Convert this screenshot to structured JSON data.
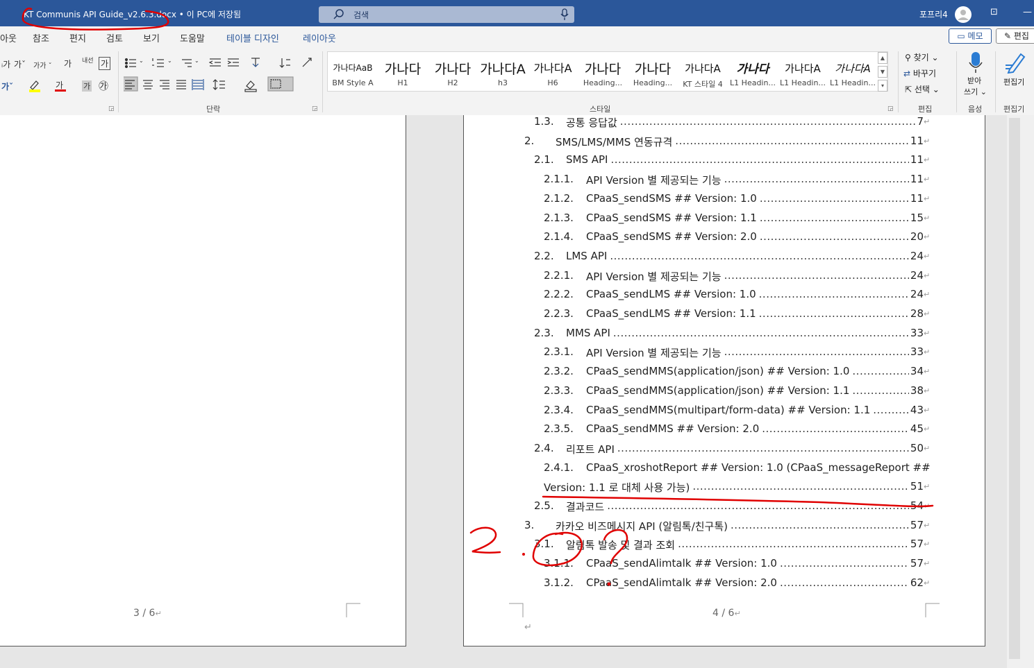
{
  "titlebar": {
    "doc_title": "KT Communis API Guide_v2.6.3.docx  •  이 PC에 저장됨",
    "search_placeholder": "검색",
    "user_name": "포프리4",
    "restore_glyph": "⊡",
    "minimize_glyph": "—"
  },
  "tabs": [
    {
      "label": "아웃"
    },
    {
      "label": "참조"
    },
    {
      "label": "편지"
    },
    {
      "label": "검토"
    },
    {
      "label": "보기"
    },
    {
      "label": "도움말"
    },
    {
      "label": "테이블 디자인"
    },
    {
      "label": "레이아웃"
    }
  ],
  "buttons": {
    "memo": "메모",
    "edit": "편집"
  },
  "ribbon": {
    "paragraph_label": "단락",
    "styles_label": "스타일",
    "editing_label": "편집",
    "voice_label": "음성",
    "editor_label": "편집기",
    "find": "찾기",
    "replace": "바꾸기",
    "select": "선택",
    "dictate_1": "받아",
    "dictate_2": "쓰기",
    "editor_btn": "편집기",
    "font_glyphs": {
      "small_ga": "가",
      "ga": "가",
      "gaga": "가가",
      "ga2": "가",
      "naesem": "내선",
      "box_ga": "가",
      "chars": "가",
      "red_ga": "가",
      "gray_ga": "가",
      "circle_ga": "㉮"
    }
  },
  "styles": [
    {
      "sample": "가나다AaB",
      "name": "BM Style A",
      "small": true
    },
    {
      "sample": "가나다",
      "name": "H1"
    },
    {
      "sample": "가나다",
      "name": "H2"
    },
    {
      "sample": "가나다A",
      "name": "h3"
    },
    {
      "sample": "가나다A",
      "name": "H6"
    },
    {
      "sample": "가나다",
      "name": "Heading..."
    },
    {
      "sample": "가나다",
      "name": "Heading..."
    },
    {
      "sample": "가나다A",
      "name": "KT 스타일 4"
    },
    {
      "sample": "가나다",
      "name": "L1 Headin..."
    },
    {
      "sample": "가나다A",
      "name": "L1 Headin..."
    },
    {
      "sample": "가나다A",
      "name": "L1 Headin..."
    }
  ],
  "toc": [
    {
      "num": "1.3.",
      "text": "공통 응답값",
      "page": "7"
    },
    {
      "num": "2.",
      "text": "SMS/LMS/MMS 연동규격",
      "page": "11"
    },
    {
      "num": "2.1.",
      "text": "SMS API",
      "page": "11"
    },
    {
      "num": "2.1.1.",
      "text": "API Version 별 제공되는 기능",
      "page": "11"
    },
    {
      "num": "2.1.2.",
      "text": "CPaaS_sendSMS ## Version: 1.0",
      "page": "11"
    },
    {
      "num": "2.1.3.",
      "text": "CPaaS_sendSMS ## Version: 1.1",
      "page": "15"
    },
    {
      "num": "2.1.4.",
      "text": "CPaaS_sendSMS ## Version: 2.0",
      "page": "20"
    },
    {
      "num": "2.2.",
      "text": "LMS API",
      "page": "24"
    },
    {
      "num": "2.2.1.",
      "text": "API Version 별 제공되는 기능",
      "page": "24"
    },
    {
      "num": "2.2.2.",
      "text": "CPaaS_sendLMS ## Version: 1.0",
      "page": "24"
    },
    {
      "num": "2.2.3.",
      "text": "CPaaS_sendLMS ## Version: 1.1",
      "page": "28"
    },
    {
      "num": "2.3.",
      "text": "MMS API",
      "page": "33"
    },
    {
      "num": "2.3.1.",
      "text": "API Version 별 제공되는 기능",
      "page": "33"
    },
    {
      "num": "2.3.2.",
      "text": "CPaaS_sendMMS(application/json) ## Version: 1.0",
      "page": "34"
    },
    {
      "num": "2.3.3.",
      "text": "CPaaS_sendMMS(application/json) ## Version: 1.1",
      "page": "38"
    },
    {
      "num": "2.3.4.",
      "text": "CPaaS_sendMMS(multipart/form-data) ## Version: 1.1",
      "page": "43"
    },
    {
      "num": "2.3.5.",
      "text": "CPaaS_sendMMS ## Version: 2.0",
      "page": "45"
    },
    {
      "num": "2.4.",
      "text": "리포트 API",
      "page": "50"
    },
    {
      "num": "2.4.1.",
      "text": "CPaaS_xroshotReport ## Version: 1.0 (CPaaS_messageReport  ##",
      "page": ""
    },
    {
      "num": "",
      "text": "Version: 1.1 로 대체 사용 가능)",
      "page": "51"
    },
    {
      "num": "2.5.",
      "text": "결과코드",
      "page": "54"
    },
    {
      "num": "3.",
      "text": "카카오 비즈메시지 API (알림톡/친구톡)",
      "page": "57"
    },
    {
      "num": "3.1.",
      "text": "알림톡 발송 및 결과 조회",
      "page": "57"
    },
    {
      "num": "3.1.1.",
      "text": "CPaaS_sendAlimtalk ## Version: 1.0",
      "page": "57"
    },
    {
      "num": "3.1.2.",
      "text": "CPaaS_sendAlimtalk ## Version: 2.0",
      "page": "62"
    }
  ],
  "return_mark": "↵",
  "page_left_footer": "3 / 6",
  "page_right_footer": "4 / 6",
  "colors": {
    "titlebar": "#2b579a",
    "annotation": "#e00000"
  }
}
